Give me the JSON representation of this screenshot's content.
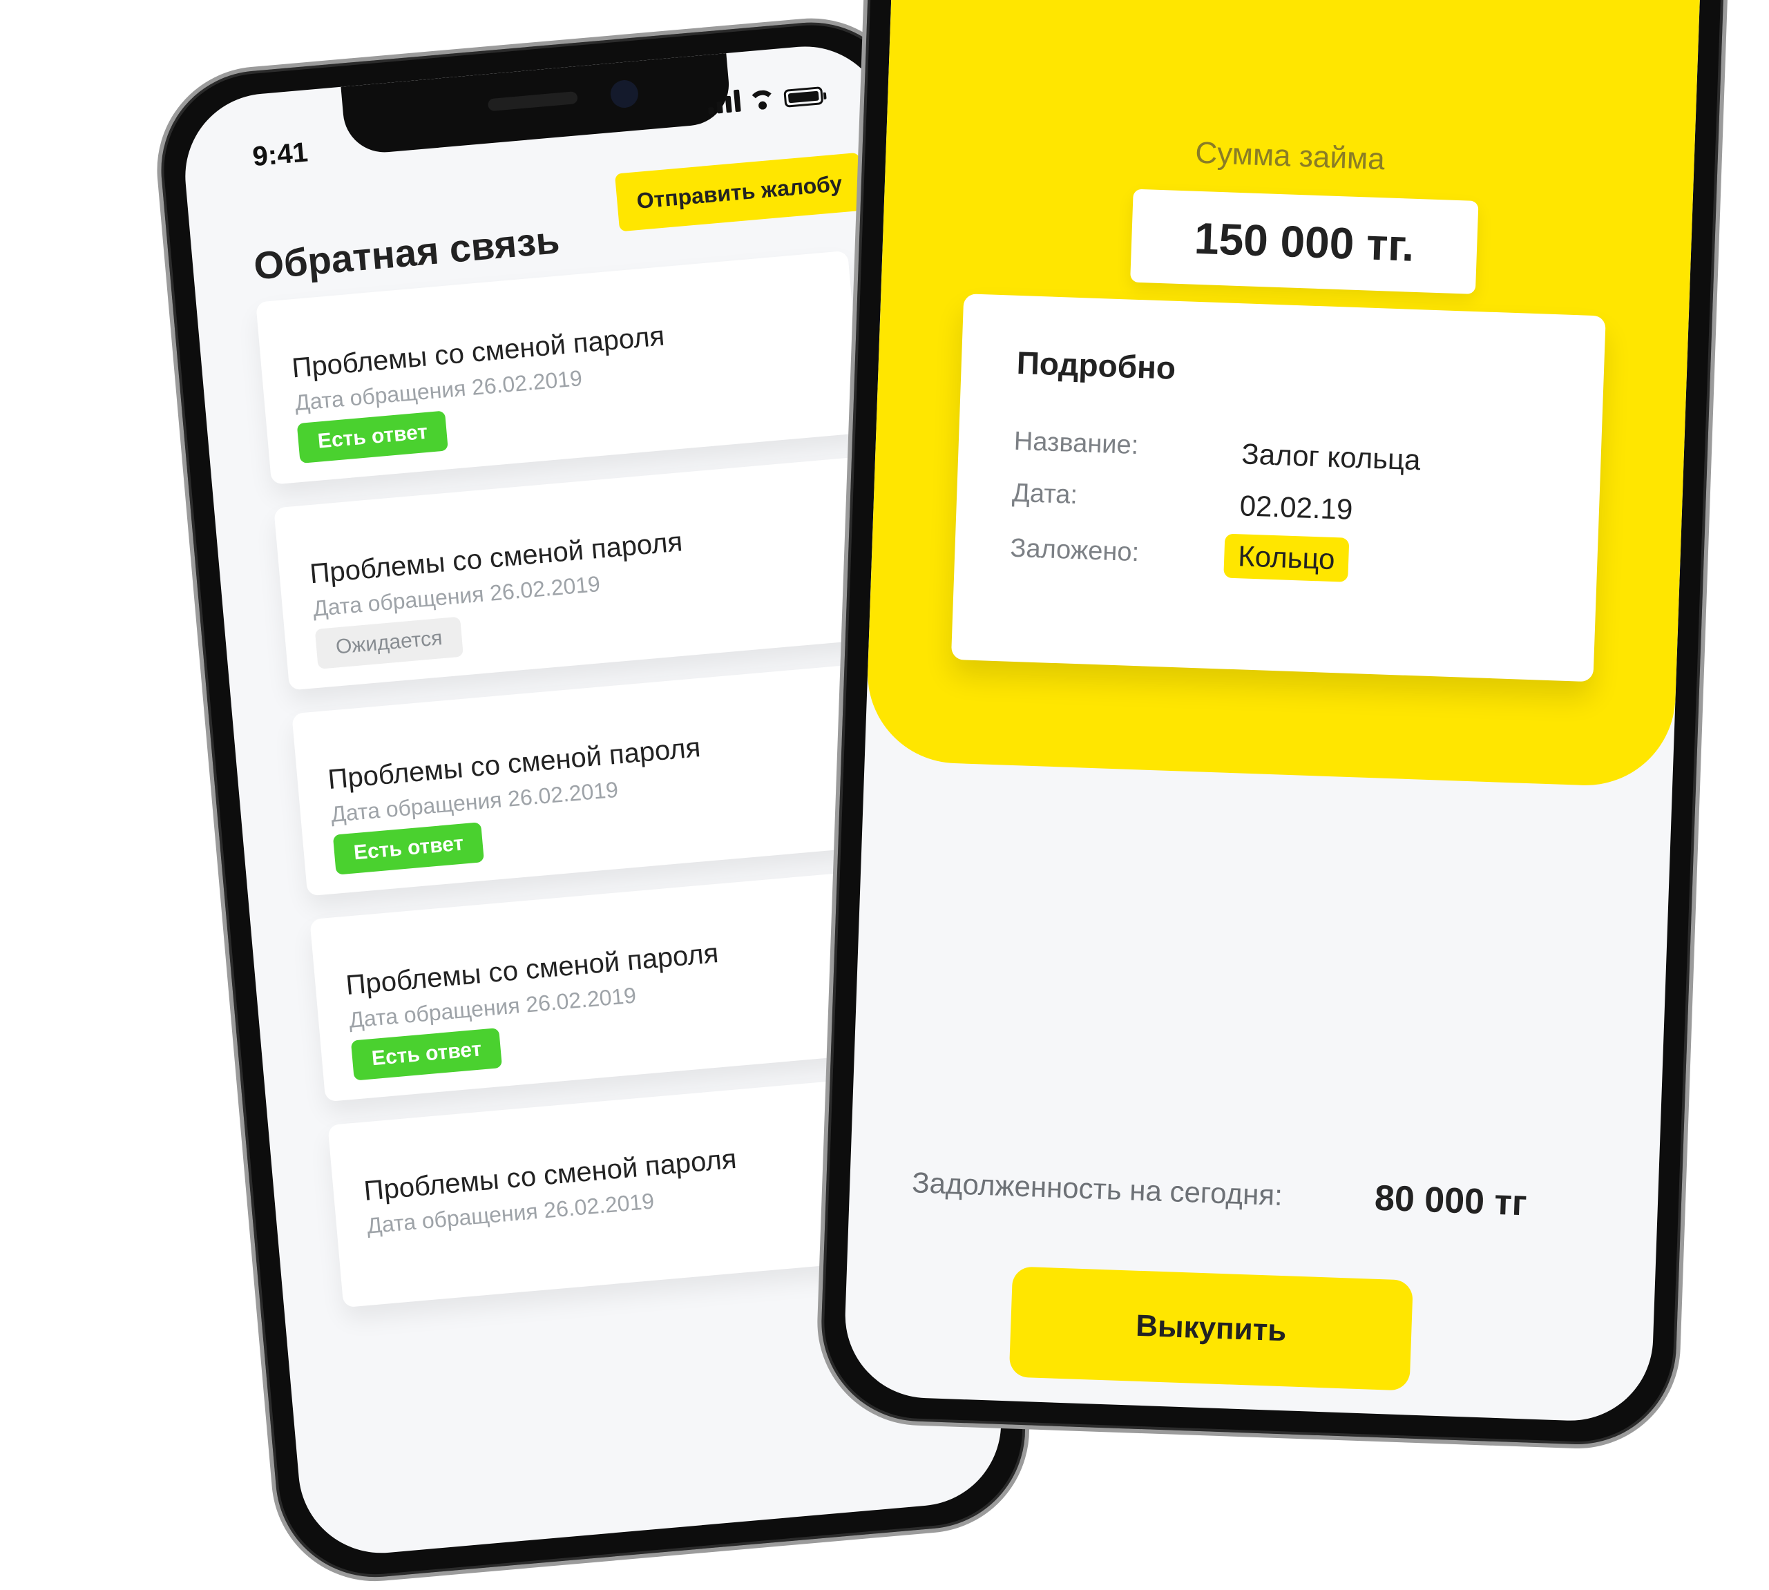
{
  "left_phone": {
    "status_bar": {
      "time": "9:41"
    },
    "header": {
      "title": "Обратная связь",
      "complaint_button": "Отправить жалобу"
    },
    "feedback_items": [
      {
        "title": "Проблемы со сменой пароля",
        "date": "Дата обращения 26.02.2019",
        "status": "Есть ответ",
        "status_type": "answered"
      },
      {
        "title": "Проблемы со сменой пароля",
        "date": "Дата обращения 26.02.2019",
        "status": "Ожидается",
        "status_type": "pending"
      },
      {
        "title": "Проблемы со сменой пароля",
        "date": "Дата обращения 26.02.2019",
        "status": "Есть ответ",
        "status_type": "answered"
      },
      {
        "title": "Проблемы со сменой пароля",
        "date": "Дата обращения 26.02.2019",
        "status": "Есть ответ",
        "status_type": "answered"
      },
      {
        "title": "Проблемы со сменой пароля",
        "date": "Дата обращения 26.02.2019",
        "status": "",
        "status_type": ""
      }
    ],
    "colors": {
      "accent": "#ffe600",
      "answered": "#4ad12f",
      "pending": "#eeeeee"
    }
  },
  "right_phone": {
    "loan": {
      "label": "Сумма займа",
      "amount": "150 000 тг."
    },
    "details": {
      "title": "Подробно",
      "rows": [
        {
          "label": "Название:",
          "value": "Залог кольца"
        },
        {
          "label": "Дата:",
          "value": "02.02.19"
        },
        {
          "label": "Заложено:",
          "value": "Кольцо"
        }
      ]
    },
    "debt": {
      "label": "Задолженность на сегодня:",
      "value": "80 000 тг"
    },
    "pay_button": "Выкупить",
    "colors": {
      "accent": "#ffe600"
    }
  }
}
